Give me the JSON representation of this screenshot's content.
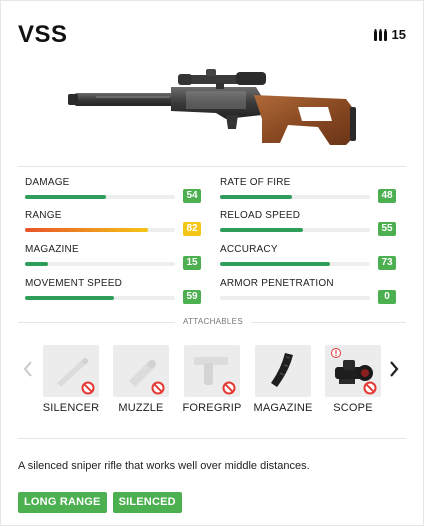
{
  "weapon": {
    "name": "VSS",
    "ammo_count": "15",
    "description": "A silenced sniper rifle that works well over middle distances."
  },
  "stats": [
    {
      "label": "DAMAGE",
      "value": "54",
      "fill": 0.54,
      "bar_color": "#2e9e5a",
      "badge_color": "#4caf50"
    },
    {
      "label": "RATE OF FIRE",
      "value": "48",
      "fill": 0.48,
      "bar_color": "#2e9e5a",
      "badge_color": "#4caf50"
    },
    {
      "label": "RANGE",
      "value": "82",
      "fill": 0.82,
      "bar_color": "gradient-orange",
      "badge_color": "#f5c518"
    },
    {
      "label": "RELOAD SPEED",
      "value": "55",
      "fill": 0.55,
      "bar_color": "#2e9e5a",
      "badge_color": "#4caf50"
    },
    {
      "label": "MAGAZINE",
      "value": "15",
      "fill": 0.15,
      "bar_color": "#2e9e5a",
      "badge_color": "#4caf50"
    },
    {
      "label": "ACCURACY",
      "value": "73",
      "fill": 0.73,
      "bar_color": "#2e9e5a",
      "badge_color": "#4caf50"
    },
    {
      "label": "MOVEMENT SPEED",
      "value": "59",
      "fill": 0.59,
      "bar_color": "#2e9e5a",
      "badge_color": "#4caf50"
    },
    {
      "label": "ARMOR PENETRATION",
      "value": "0",
      "fill": 0.0,
      "bar_color": "#2e9e5a",
      "badge_color": "#4caf50"
    }
  ],
  "attachables": {
    "heading": "ATTACHABLES",
    "slots": [
      {
        "name": "SILENCER",
        "icon": "silencer-icon",
        "blocked": true,
        "warning": false
      },
      {
        "name": "MUZZLE",
        "icon": "muzzle-icon",
        "blocked": true,
        "warning": false
      },
      {
        "name": "FOREGRIP",
        "icon": "foregrip-icon",
        "blocked": true,
        "warning": false
      },
      {
        "name": "MAGAZINE",
        "icon": "magazine-icon",
        "blocked": false,
        "warning": false
      },
      {
        "name": "SCOPE",
        "icon": "scope-icon",
        "blocked": true,
        "warning": true
      }
    ]
  },
  "tags": [
    "LONG RANGE",
    "SILENCED"
  ],
  "colors": {
    "accent_green": "#4caf50",
    "accent_yellow": "#f5c518",
    "blocked_red": "#e53935"
  }
}
